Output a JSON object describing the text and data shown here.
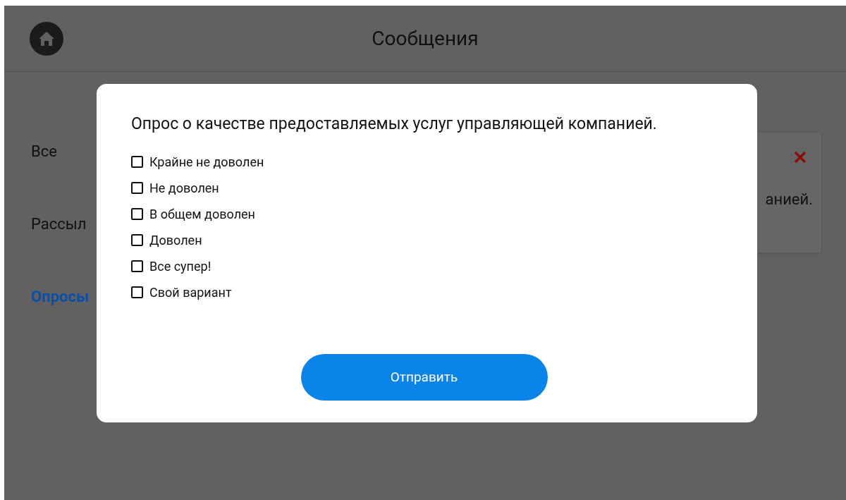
{
  "header": {
    "title": "Сообщения"
  },
  "sidebar": {
    "items": [
      {
        "label": "Все",
        "selected": false
      },
      {
        "label": "Рассыл",
        "selected": false
      },
      {
        "label": "Опросы",
        "selected": true
      }
    ]
  },
  "message_card": {
    "text": "анией."
  },
  "dialog": {
    "question": "Опрос о качестве предоставляемых услуг управляющей компанией.",
    "options": [
      {
        "label": "Крайне не доволен",
        "checked": false
      },
      {
        "label": "Не доволен",
        "checked": false
      },
      {
        "label": "В общем доволен",
        "checked": false
      },
      {
        "label": "Доволен",
        "checked": false
      },
      {
        "label": "Все супер!",
        "checked": false
      },
      {
        "label": "Свой вариант",
        "checked": false
      }
    ],
    "submit": "Отправить"
  }
}
